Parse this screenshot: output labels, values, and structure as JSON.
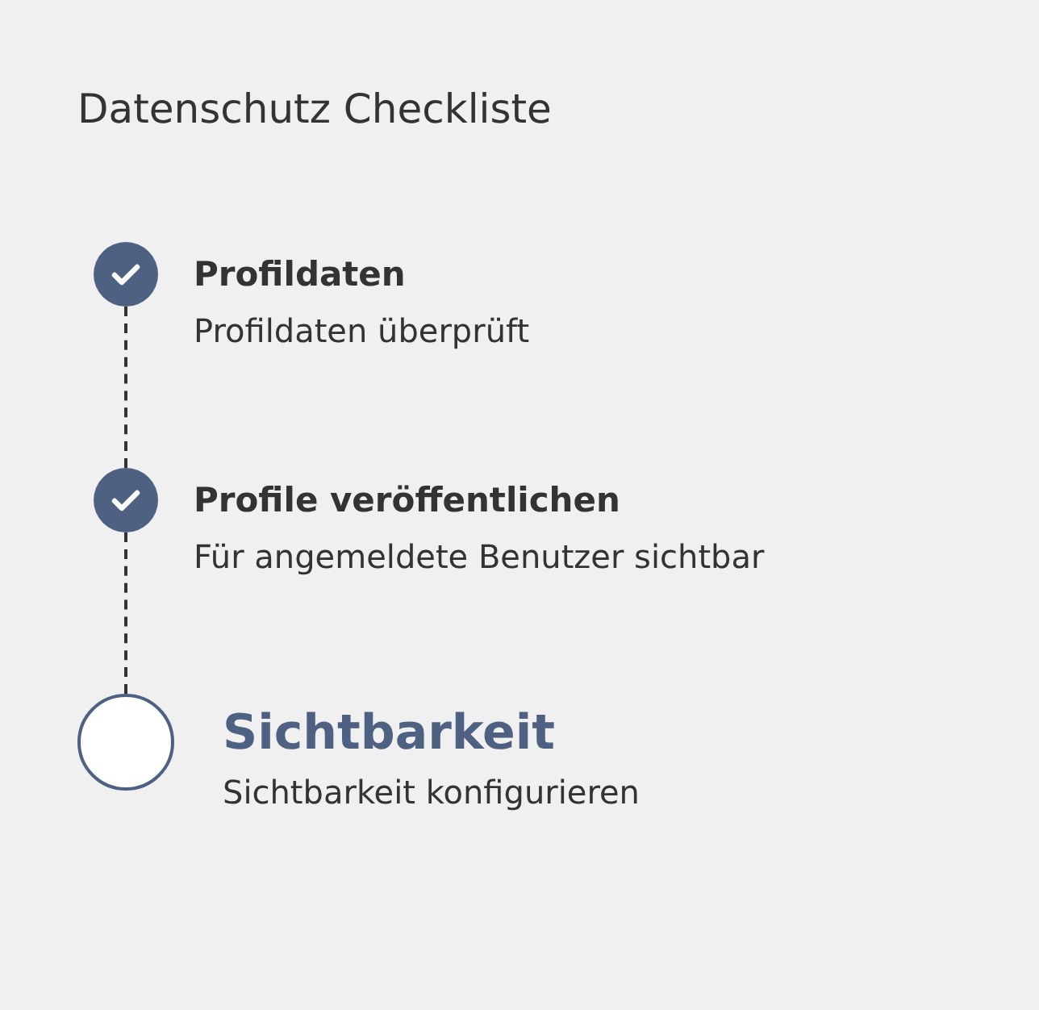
{
  "title": "Datenschutz Checkliste",
  "steps": [
    {
      "title": "Profildaten",
      "description": "Profildaten überprüft",
      "completed": true
    },
    {
      "title": "Profile veröffentlichen",
      "description": "Für angemeldete Benutzer sichtbar",
      "completed": true
    },
    {
      "title": "Sichtbarkeit",
      "description": "Sichtbarkeit konfigurieren",
      "completed": false
    }
  ]
}
